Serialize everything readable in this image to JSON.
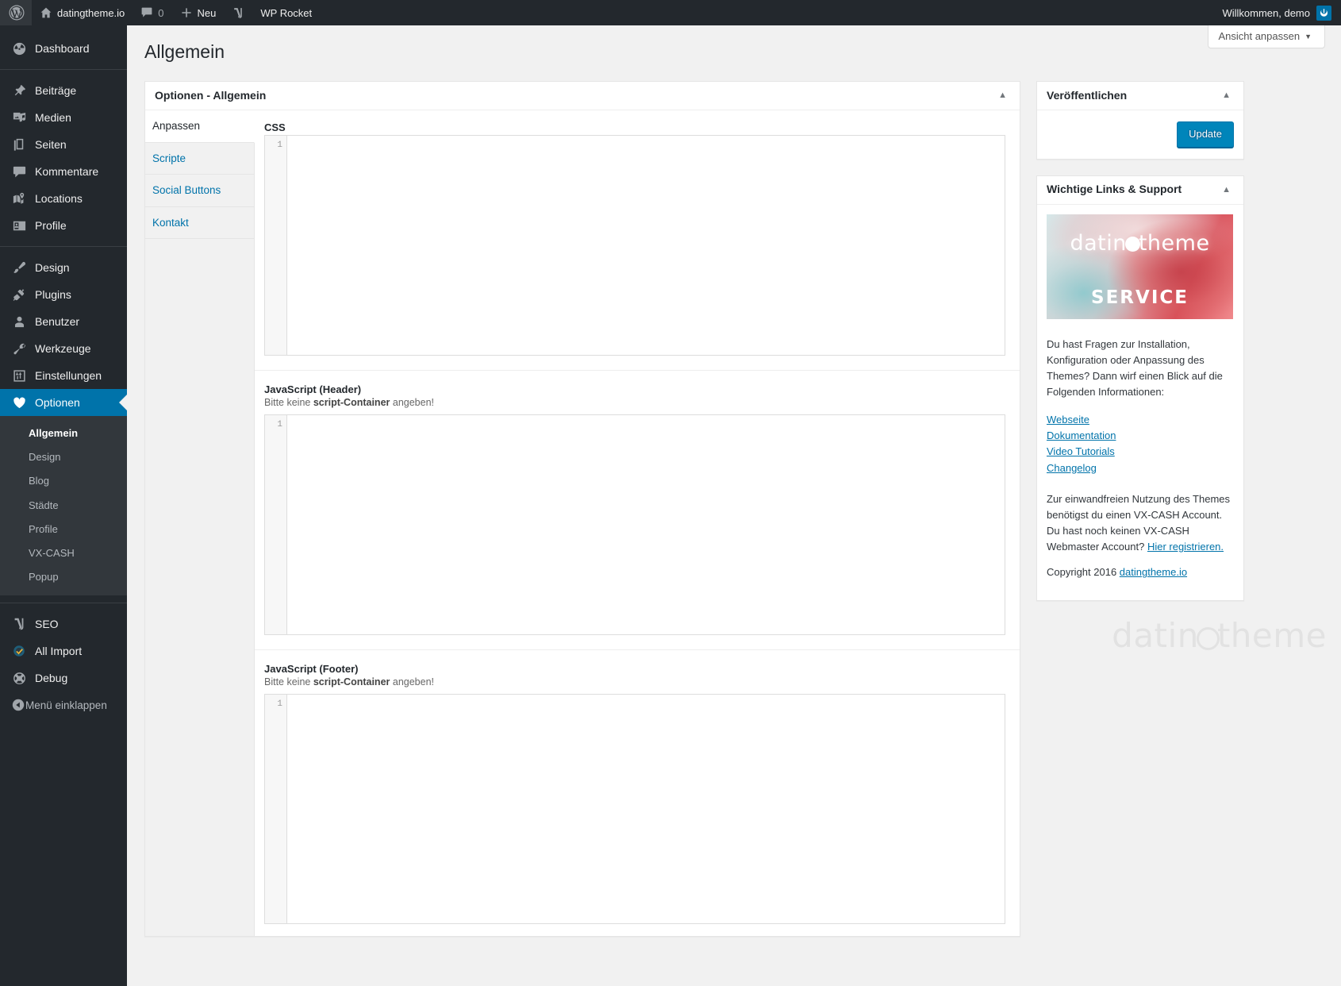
{
  "adminbar": {
    "logo_icon": "wordpress-logo-icon",
    "site_name": "datingtheme.io",
    "site_icon": "home-icon",
    "comments_icon": "comment-bubble-icon",
    "comments_count": "0",
    "new_icon": "plus-icon",
    "new_label": "Neu",
    "seo_icon": "yoast-seo-icon",
    "wp_rocket_label": "WP Rocket",
    "greeting": "Willkommen, demo",
    "logout_icon": "power-icon"
  },
  "sidebar": {
    "items": [
      {
        "label": "Dashboard",
        "icon": "dashboard-icon",
        "sep_after": true
      },
      {
        "label": "Beiträge",
        "icon": "pin-icon"
      },
      {
        "label": "Medien",
        "icon": "media-icon"
      },
      {
        "label": "Seiten",
        "icon": "pages-icon"
      },
      {
        "label": "Kommentare",
        "icon": "comment-icon"
      },
      {
        "label": "Locations",
        "icon": "map-marker-icon"
      },
      {
        "label": "Profile",
        "icon": "id-card-icon",
        "sep_after": true
      },
      {
        "label": "Design",
        "icon": "paintbrush-icon"
      },
      {
        "label": "Plugins",
        "icon": "plug-icon"
      },
      {
        "label": "Benutzer",
        "icon": "user-icon"
      },
      {
        "label": "Werkzeuge",
        "icon": "wrench-icon"
      },
      {
        "label": "Einstellungen",
        "icon": "settings-sliders-icon"
      },
      {
        "label": "Optionen",
        "icon": "heart-icon",
        "current": true
      }
    ],
    "submenu": [
      {
        "label": "Allgemein",
        "current": true
      },
      {
        "label": "Design"
      },
      {
        "label": "Blog"
      },
      {
        "label": "Städte"
      },
      {
        "label": "Profile"
      },
      {
        "label": "VX-CASH"
      },
      {
        "label": "Popup"
      }
    ],
    "plugins": [
      {
        "label": "SEO",
        "icon": "yoast-seo-icon"
      },
      {
        "label": "All Import",
        "icon": "all-import-icon"
      },
      {
        "label": "Debug",
        "icon": "debug-icon"
      }
    ],
    "collapse": {
      "label": "Menü einklappen",
      "icon": "collapse-arrow-icon"
    }
  },
  "screen_options": {
    "label": "Ansicht anpassen",
    "caret": "▼"
  },
  "page": {
    "title": "Allgemein"
  },
  "options_box": {
    "title": "Optionen - Allgemein",
    "toggle_icon": "chevron-up-icon",
    "tabs": [
      {
        "label": "Anpassen",
        "active": true
      },
      {
        "label": "Scripte",
        "active": false
      },
      {
        "label": "Social Buttons",
        "active": false
      },
      {
        "label": "Kontakt",
        "active": false
      }
    ],
    "fields": [
      {
        "label": "CSS",
        "description": "",
        "line_number": "1",
        "value": "",
        "editor_height": "h-css"
      },
      {
        "label": "JavaScript (Header)",
        "description_pre": "Bitte keine ",
        "description_bold": "script-Container",
        "description_post": " angeben!",
        "line_number": "1",
        "value": "",
        "editor_height": "h-js1"
      },
      {
        "label": "JavaScript (Footer)",
        "description_pre": "Bitte keine ",
        "description_bold": "script-Container",
        "description_post": " angeben!",
        "line_number": "1",
        "value": "",
        "editor_height": "h-js2"
      }
    ]
  },
  "publish_box": {
    "title": "Veröffentlichen",
    "toggle_icon": "chevron-up-icon",
    "update_label": "Update"
  },
  "support_box": {
    "title": "Wichtige Links & Support",
    "toggle_icon": "chevron-up-icon",
    "banner": {
      "logo_text_a": "datin",
      "logo_text_b": "theme",
      "service_text": "SERVICE"
    },
    "intro": "Du hast Fragen zur Installation, Konfiguration oder Anpassung des Themes? Dann wirf einen Blick auf die Folgenden Informationen:",
    "links": [
      "Webseite",
      "Dokumentation",
      "Video Tutorials",
      "Changelog"
    ],
    "vxcash_pre": "Zur einwandfreien Nutzung des Themes benötigst du einen VX-CASH Account. Du hast noch keinen VX-CASH Webmaster Account? ",
    "vxcash_link": "Hier registrieren.",
    "copyright_pre": "Copyright 2016 ",
    "copyright_link": "datingtheme.io"
  },
  "watermark": {
    "text_a": "datin",
    "text_b": "theme"
  },
  "colors": {
    "accent": "#0073aa",
    "admin_bg": "#23282d",
    "submenu_bg": "#32373c",
    "button_primary": "#0085ba",
    "link": "#0073aa"
  }
}
